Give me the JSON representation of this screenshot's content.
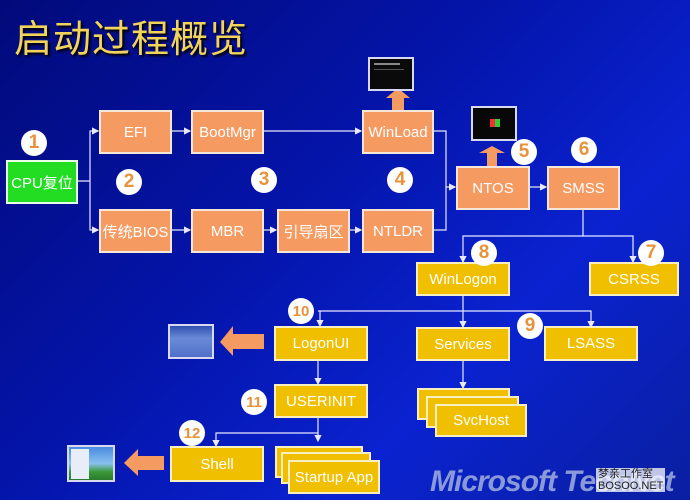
{
  "title": "启动过程概览",
  "nodes": {
    "cpu_reset": "CPU复位",
    "efi": "EFI",
    "bootmgr": "BootMgr",
    "winload": "WinLoad",
    "legacy_bios": "传统BIOS",
    "mbr": "MBR",
    "boot_sector": "引导扇区",
    "ntldr": "NTLDR",
    "ntos": "NTOS",
    "smss": "SMSS",
    "winlogon": "WinLogon",
    "csrss": "CSRSS",
    "logonui": "LogonUI",
    "services": "Services",
    "lsass": "LSASS",
    "svchost": "SvcHost",
    "userinit": "USERINIT",
    "shell": "Shell",
    "startup_app": "Startup App"
  },
  "steps": [
    "1",
    "2",
    "3",
    "4",
    "5",
    "6",
    "7",
    "8",
    "9",
    "10",
    "11",
    "12"
  ],
  "footer": {
    "brand": "Microsoft TechNet",
    "watermark_line1": "梦亲工作室",
    "watermark_line2": "BOSOO.NET"
  },
  "colors": {
    "orange": "#f59a60",
    "yellow": "#f0c000",
    "green": "#22dd22",
    "title": "#f3d45a"
  }
}
